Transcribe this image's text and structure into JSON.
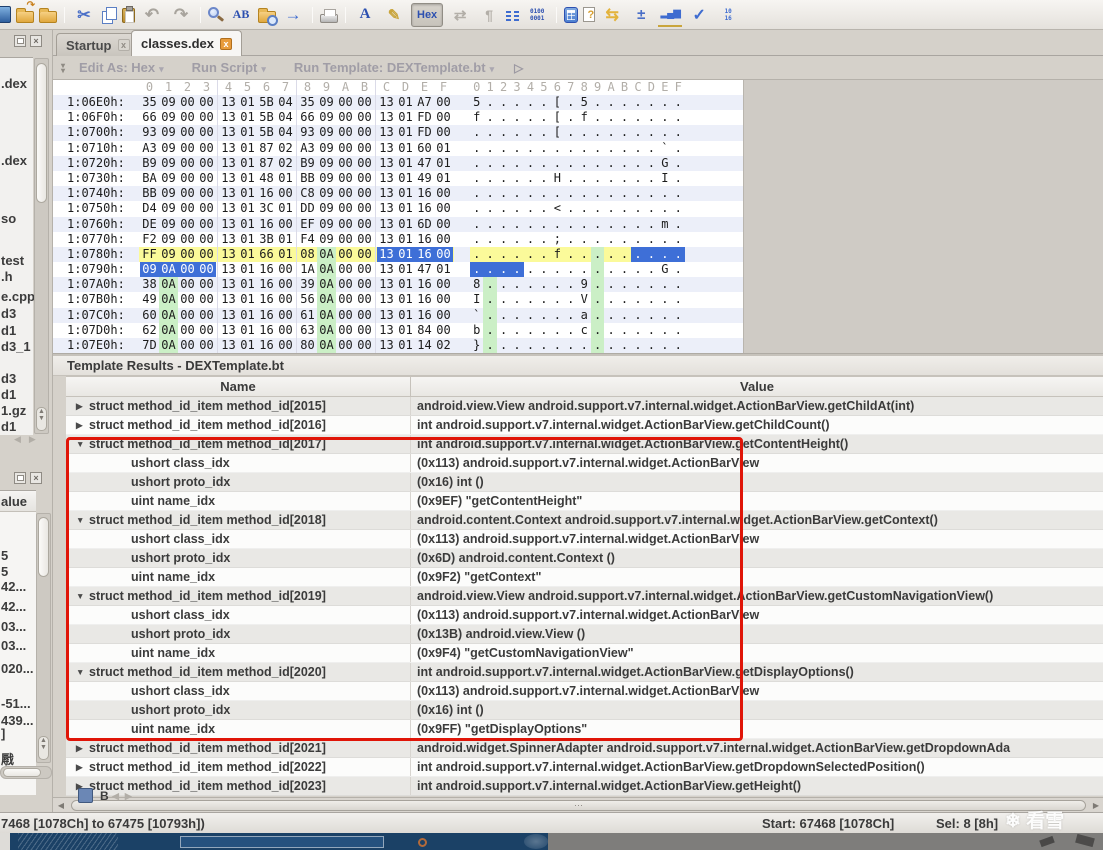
{
  "toolbar": {
    "icons": [
      {
        "name": "new-file-icon",
        "kind": "partial"
      },
      {
        "name": "open-file-icon",
        "kind": "folder-open"
      },
      {
        "name": "open-recent-icon",
        "kind": "folder"
      },
      {
        "name": "sep"
      },
      {
        "name": "cut-icon",
        "kind": "glyph",
        "glyph": "✂",
        "color": "#4A6FC7",
        "size": 16
      },
      {
        "name": "copy-icon",
        "kind": "copy"
      },
      {
        "name": "paste-icon",
        "kind": "paste"
      },
      {
        "name": "undo-icon",
        "kind": "glyph",
        "glyph": "↶",
        "color": "#A8A49D",
        "size": 17
      },
      {
        "name": "redo-icon",
        "kind": "glyph",
        "glyph": "↷",
        "color": "#A8A49D",
        "size": 17
      },
      {
        "name": "sep"
      },
      {
        "name": "find-icon",
        "kind": "mag"
      },
      {
        "name": "replace-icon",
        "kind": "ab",
        "glyph": "AB"
      },
      {
        "name": "find-in-files-icon",
        "kind": "folder-mag"
      },
      {
        "name": "goto-icon",
        "kind": "glyph",
        "glyph": "→",
        "color": "#3E6CD0",
        "size": 17
      },
      {
        "name": "sep"
      },
      {
        "name": "print-icon",
        "kind": "printer"
      },
      {
        "name": "sep"
      },
      {
        "name": "font-options-icon",
        "kind": "fontA",
        "glyph": "A"
      },
      {
        "name": "highlighter-icon",
        "kind": "glyph",
        "glyph": "✎",
        "color": "#C9A53C",
        "size": 15
      },
      {
        "name": "hex-mode-button",
        "kind": "hexbtn",
        "glyph": "Hex"
      },
      {
        "name": "swap-bytes-icon",
        "kind": "glyph",
        "glyph": "⇄",
        "color": "#B3AFA8",
        "size": 15
      },
      {
        "name": "show-whitespace-icon",
        "kind": "glyph",
        "glyph": "¶",
        "color": "#B3AFA8",
        "size": 14
      },
      {
        "name": "column-mode-icon",
        "kind": "columns"
      },
      {
        "name": "binary-view-icon",
        "kind": "binary",
        "glyph": "0100\n0001"
      },
      {
        "name": "sep"
      },
      {
        "name": "calculator-icon",
        "kind": "calc"
      },
      {
        "name": "template-help-icon",
        "kind": "docq",
        "glyph": "?"
      },
      {
        "name": "jump-arrows-icon",
        "kind": "glyph",
        "glyph": "⇆",
        "color": "#E3B33C",
        "size": 16
      },
      {
        "name": "operations-icon",
        "kind": "glyph",
        "glyph": "±",
        "color": "#4A6FC7",
        "size": 15
      },
      {
        "name": "histogram-icon",
        "kind": "bars",
        "glyph": "▂▄▆"
      },
      {
        "name": "check-script-icon",
        "kind": "glyph",
        "glyph": "✓",
        "color": "#3E6CD0",
        "size": 16
      },
      {
        "name": "base-convert-icon",
        "kind": "base",
        "glyph": "10\n16"
      }
    ]
  },
  "tabs": {
    "items": [
      {
        "label": "Startup",
        "close": "x",
        "active": false
      },
      {
        "label": "classes.dex",
        "close": "x",
        "active": true
      }
    ]
  },
  "hex_toolbar": {
    "edit_as": "Edit As: Hex",
    "run_script": "Run Script",
    "run_template": "Run Template: DEXTemplate.bt",
    "caret": "▾",
    "play": "▷"
  },
  "hex_view": {
    "hex_columns": [
      "0",
      "1",
      "2",
      "3",
      "4",
      "5",
      "6",
      "7",
      "8",
      "9",
      "A",
      "B",
      "C",
      "D",
      "E",
      "F"
    ],
    "ascii_columns": "0123456789ABCDEF",
    "rows": [
      {
        "addr": "1:06E0h:",
        "bytes": "35 09 00 00 13 01 5B 04 35 09 00 00 13 01 A7 00",
        "ascii": "5.....[.5......."
      },
      {
        "addr": "1:06F0h:",
        "bytes": "66 09 00 00 13 01 5B 04 66 09 00 00 13 01 FD 00",
        "ascii": "f.....[.f......."
      },
      {
        "addr": "1:0700h:",
        "bytes": "93 09 00 00 13 01 5B 04 93 09 00 00 13 01 FD 00",
        "ascii": "......[........."
      },
      {
        "addr": "1:0710h:",
        "bytes": "A3 09 00 00 13 01 87 02 A3 09 00 00 13 01 60 01",
        "ascii": "..............`."
      },
      {
        "addr": "1:0720h:",
        "bytes": "B9 09 00 00 13 01 87 02 B9 09 00 00 13 01 47 01",
        "ascii": "..............G."
      },
      {
        "addr": "1:0730h:",
        "bytes": "BA 09 00 00 13 01 48 01 BB 09 00 00 13 01 49 01",
        "ascii": "......H.......I."
      },
      {
        "addr": "1:0740h:",
        "bytes": "BB 09 00 00 13 01 16 00 C8 09 00 00 13 01 16 00",
        "ascii": "................"
      },
      {
        "addr": "1:0750h:",
        "bytes": "D4 09 00 00 13 01 3C 01 DD 09 00 00 13 01 16 00",
        "ascii": "......<........."
      },
      {
        "addr": "1:0760h:",
        "bytes": "DE 09 00 00 13 01 16 00 EF 09 00 00 13 01 6D 00",
        "ascii": "..............m."
      },
      {
        "addr": "1:0770h:",
        "bytes": "F2 09 00 00 13 01 3B 01 F4 09 00 00 13 01 16 00",
        "ascii": "......;........."
      },
      {
        "addr": "1:0780h:",
        "bytes": "FF 09 00 00 13 01 66 01 08 0A 00 00 13 01 16 00",
        "ascii": "......f........."
      },
      {
        "addr": "1:0790h:",
        "bytes": "09 0A 00 00 13 01 16 00 1A 0A 00 00 13 01 47 01",
        "ascii": "..............G."
      },
      {
        "addr": "1:07A0h:",
        "bytes": "38 0A 00 00 13 01 16 00 39 0A 00 00 13 01 16 00",
        "ascii": "8.......9......."
      },
      {
        "addr": "1:07B0h:",
        "bytes": "49 0A 00 00 13 01 16 00 56 0A 00 00 13 01 16 00",
        "ascii": "I.......V......."
      },
      {
        "addr": "1:07C0h:",
        "bytes": "60 0A 00 00 13 01 16 00 61 0A 00 00 13 01 16 00",
        "ascii": "`.......a......."
      },
      {
        "addr": "1:07D0h:",
        "bytes": "62 0A 00 00 13 01 16 00 63 0A 00 00 13 01 84 00",
        "ascii": "b.......c......."
      },
      {
        "addr": "1:07E0h:",
        "bytes": "7D 0A 00 00 13 01 16 00 80 0A 00 00 13 01 14 02",
        "ascii": "}..............."
      }
    ],
    "marks": {
      "yellow_row": 10,
      "selection": [
        [
          10,
          12,
          15
        ],
        [
          11,
          0,
          3
        ]
      ],
      "green": [
        [
          10,
          9
        ],
        [
          11,
          9
        ],
        [
          12,
          1
        ],
        [
          12,
          9
        ],
        [
          13,
          1
        ],
        [
          13,
          9
        ],
        [
          14,
          1
        ],
        [
          14,
          9
        ],
        [
          15,
          1
        ],
        [
          15,
          9
        ],
        [
          16,
          1
        ],
        [
          16,
          9
        ]
      ]
    },
    "colors": {
      "selection": "#3E6FD7",
      "yellow": "#FBFA9A",
      "green": "#CBEFC6",
      "alt_row": "#ECEFF9"
    }
  },
  "template_results": {
    "title": "Template Results - DEXTemplate.bt",
    "name_header": "Name",
    "value_header": "Value",
    "rows": [
      {
        "arrow": "▶",
        "indent": 0,
        "name": "struct method_id_item method_id[2015]",
        "value": "android.view.View android.support.v7.internal.widget.ActionBarView.getChildAt(int)"
      },
      {
        "arrow": "▶",
        "indent": 0,
        "name": "struct method_id_item method_id[2016]",
        "value": "int android.support.v7.internal.widget.ActionBarView.getChildCount()"
      },
      {
        "arrow": "▼",
        "indent": 0,
        "name": "struct method_id_item method_id[2017]",
        "value": "int android.support.v7.internal.widget.ActionBarView.getContentHeight()"
      },
      {
        "arrow": "",
        "indent": 1,
        "name": "ushort class_idx",
        "value": "(0x113) android.support.v7.internal.widget.ActionBarView"
      },
      {
        "arrow": "",
        "indent": 1,
        "name": "ushort proto_idx",
        "value": "(0x16) int ()"
      },
      {
        "arrow": "",
        "indent": 1,
        "name": "uint name_idx",
        "value": "(0x9EF) \"getContentHeight\""
      },
      {
        "arrow": "▼",
        "indent": 0,
        "name": "struct method_id_item method_id[2018]",
        "value": "android.content.Context android.support.v7.internal.widget.ActionBarView.getContext()"
      },
      {
        "arrow": "",
        "indent": 1,
        "name": "ushort class_idx",
        "value": "(0x113) android.support.v7.internal.widget.ActionBarView"
      },
      {
        "arrow": "",
        "indent": 1,
        "name": "ushort proto_idx",
        "value": "(0x6D) android.content.Context ()"
      },
      {
        "arrow": "",
        "indent": 1,
        "name": "uint name_idx",
        "value": "(0x9F2) \"getContext\""
      },
      {
        "arrow": "▼",
        "indent": 0,
        "name": "struct method_id_item method_id[2019]",
        "value": "android.view.View android.support.v7.internal.widget.ActionBarView.getCustomNavigationView()"
      },
      {
        "arrow": "",
        "indent": 1,
        "name": "ushort class_idx",
        "value": "(0x113) android.support.v7.internal.widget.ActionBarView"
      },
      {
        "arrow": "",
        "indent": 1,
        "name": "ushort proto_idx",
        "value": "(0x13B) android.view.View ()"
      },
      {
        "arrow": "",
        "indent": 1,
        "name": "uint name_idx",
        "value": "(0x9F4) \"getCustomNavigationView\""
      },
      {
        "arrow": "▼",
        "indent": 0,
        "name": "struct method_id_item method_id[2020]",
        "value": "int android.support.v7.internal.widget.ActionBarView.getDisplayOptions()"
      },
      {
        "arrow": "",
        "indent": 1,
        "name": "ushort class_idx",
        "value": "(0x113) android.support.v7.internal.widget.ActionBarView"
      },
      {
        "arrow": "",
        "indent": 1,
        "name": "ushort proto_idx",
        "value": "(0x16) int ()"
      },
      {
        "arrow": "",
        "indent": 1,
        "name": "uint name_idx",
        "value": "(0x9FF) \"getDisplayOptions\""
      },
      {
        "arrow": "▶",
        "indent": 0,
        "name": "struct method_id_item method_id[2021]",
        "value": "android.widget.SpinnerAdapter android.support.v7.internal.widget.ActionBarView.getDropdownAda"
      },
      {
        "arrow": "▶",
        "indent": 0,
        "name": "struct method_id_item method_id[2022]",
        "value": "int android.support.v7.internal.widget.ActionBarView.getDropdownSelectedPosition()"
      },
      {
        "arrow": "▶",
        "indent": 0,
        "name": "struct method_id_item method_id[2023]",
        "value": "int android.support.v7.internal.widget.ActionBarView.getHeight()"
      }
    ]
  },
  "left_dock": {
    "files": [
      ".dex",
      ".dex",
      "so",
      "test",
      ".h",
      "e.cpp",
      "d3",
      "d1",
      "d3_1",
      "d3",
      "d1",
      "1.gz",
      "d1"
    ],
    "values_header": "alue",
    "values": [
      "5",
      "5",
      "42...",
      "42...",
      "03...",
      "03...",
      "020...",
      "-51...",
      "439...",
      "]",
      "㦺"
    ],
    "bottom_tab": "B",
    "close_glyph": "×",
    "nav_left": "◀",
    "nav_right": "▶",
    "step_up": "▲",
    "step_down": "▼"
  },
  "template_scrollbar": {
    "left_arrow": "◀",
    "right_arrow": "▶",
    "grip": "⋯"
  },
  "status_bar": {
    "left": "7468 [1078Ch] to 67475 [10793h])",
    "start": "Start: 67468 [1078Ch]",
    "sel": "Sel: 8 [8h]",
    "watermark": "❄ 看雪"
  }
}
